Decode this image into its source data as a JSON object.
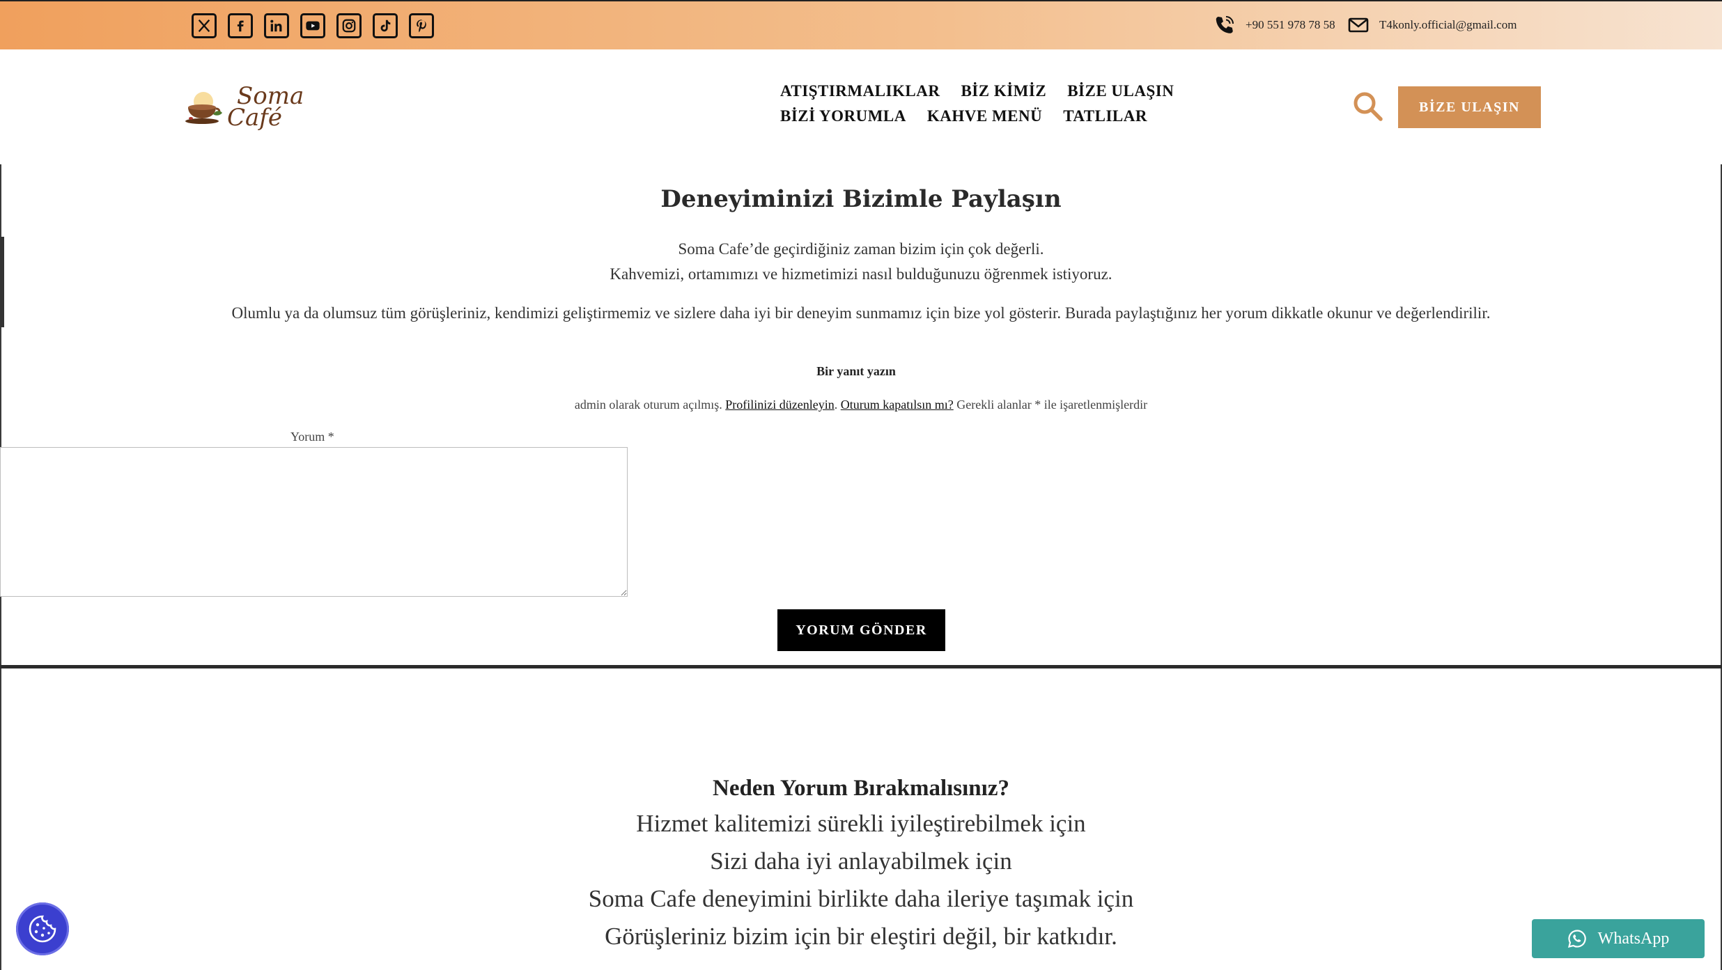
{
  "topbar": {
    "socials": [
      {
        "icon": "x-twitter-icon"
      },
      {
        "icon": "facebook-icon"
      },
      {
        "icon": "linkedin-icon"
      },
      {
        "icon": "youtube-icon"
      },
      {
        "icon": "instagram-icon"
      },
      {
        "icon": "tiktok-icon"
      },
      {
        "icon": "pinterest-icon"
      }
    ],
    "phone": "+90 551 978 78 58",
    "email": "T4konly.official@gmail.com"
  },
  "header": {
    "logo_line1": "Soma",
    "logo_line2": "Café",
    "nav": [
      "ATIŞTIRMALIKLAR",
      "BİZ KİMİZ",
      "BİZE ULAŞIN",
      "BİZİ YORUMLA",
      "KAHVE MENÜ",
      "TATLILAR"
    ],
    "cta_label": "BİZE ULAŞIN"
  },
  "main": {
    "title": "Deneyiminizi Bizimle Paylaşın",
    "intro_line1": "Soma Cafe’de geçirdiğiniz zaman bizim için çok değerli.",
    "intro_line2": "Kahvemizi, ortamımızı ve hizmetimizi nasıl bulduğunuzu öğrenmek istiyoruz.",
    "paragraph": "Olumlu ya da olumsuz tüm görüşleriniz, kendimizi geliştirmemiz ve sizlere daha iyi bir deneyim sunmamız için bize yol gösterir. Burada paylaştığınız her yorum dikkatle okunur ve değerlendirilir."
  },
  "comment_form": {
    "reply_title": "Bir yanıt yazın",
    "logged_prefix": "admin olarak oturum açılmış.",
    "edit_profile_link": "Profilinizi düzenleyin",
    "logout_link": "Oturum kapatılsın mı?",
    "required_note": "Gerekli alanlar * ile işaretlenmişlerdir",
    "comment_label": "Yorum *",
    "comment_value": "",
    "submit_label": "YORUM GÖNDER"
  },
  "why": {
    "title": "Neden Yorum Bırakmalısınız?",
    "lines": [
      "Hizmet kalitemizi sürekli iyileştirebilmek için",
      "Sizi daha iyi anlayabilmek için",
      "Soma Cafe deneyimini birlikte daha ileriye taşımak için",
      "Görüşleriniz bizim için bir eleştiri değil, bir katkıdır."
    ]
  },
  "floating": {
    "whatsapp_label": "WhatsApp",
    "cookie_icon": "cookie-icon"
  },
  "colors": {
    "topbar_start": "#f0a05d",
    "topbar_end": "#f7e3d1",
    "accent": "#d39156",
    "whatsapp": "#3aa39c",
    "cookie": "#3b3fcf"
  }
}
